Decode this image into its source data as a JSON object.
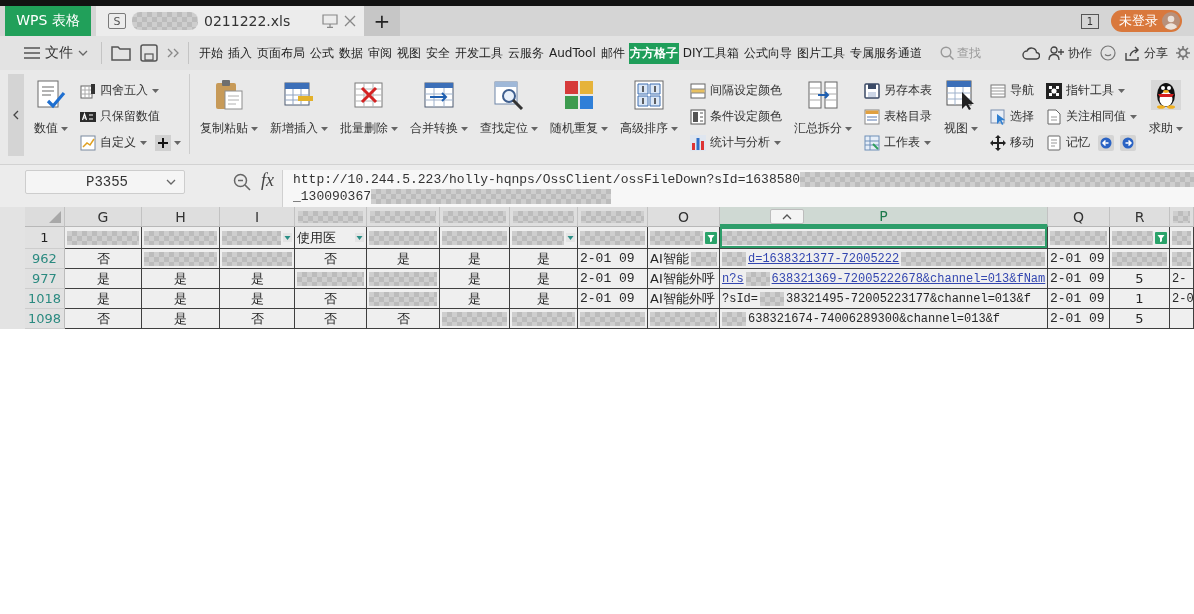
{
  "title_bar": {
    "app_tab": "WPS 表格",
    "file_tab": {
      "icon_letter": "S",
      "redacted": true,
      "name": "0211222.xls"
    },
    "new_tab": "+",
    "window_count": "1",
    "account": "未登录"
  },
  "menu_bar": {
    "file_menu": "文件",
    "tabs": [
      {
        "label": "开始",
        "selected": false
      },
      {
        "label": "插入",
        "selected": false
      },
      {
        "label": "页面布局",
        "selected": false
      },
      {
        "label": "公式",
        "selected": false
      },
      {
        "label": "数据",
        "selected": false
      },
      {
        "label": "审阅",
        "selected": false
      },
      {
        "label": "视图",
        "selected": false
      },
      {
        "label": "安全",
        "selected": false
      },
      {
        "label": "开发工具",
        "selected": false
      },
      {
        "label": "云服务",
        "selected": false
      },
      {
        "label": "AudTool",
        "selected": false
      },
      {
        "label": "邮件",
        "selected": false
      },
      {
        "label": "方方格子",
        "selected": true
      },
      {
        "label": "DIY工具箱",
        "selected": false
      },
      {
        "label": "公式向导",
        "selected": false
      },
      {
        "label": "图片工具",
        "selected": false
      },
      {
        "label": "专属服务通道",
        "selected": false
      }
    ],
    "search": {
      "placeholder": "查找"
    },
    "collaborate": "协作",
    "share": "分享"
  },
  "ribbon": {
    "sections": [
      {
        "kind": "large",
        "label": "数值",
        "dropdown": true
      },
      {
        "kind": "stack",
        "rows": [
          [
            {
              "label": "四舍五入",
              "dropdown": true
            }
          ],
          [
            {
              "label": "只保留数值",
              "dropdown": false
            }
          ],
          [
            {
              "label": "自定义",
              "dropdown": true
            },
            {
              "dropdown": true
            }
          ]
        ]
      },
      {
        "kind": "separator"
      },
      {
        "kind": "large",
        "label": "复制粘贴",
        "dropdown": true
      },
      {
        "kind": "large",
        "label": "新增插入",
        "dropdown": true
      },
      {
        "kind": "large",
        "label": "批量删除",
        "dropdown": true
      },
      {
        "kind": "large",
        "label": "合并转换",
        "dropdown": true
      },
      {
        "kind": "large",
        "label": "查找定位",
        "dropdown": true
      },
      {
        "kind": "large",
        "label": "随机重复",
        "dropdown": true
      },
      {
        "kind": "large",
        "label": "高级排序",
        "dropdown": true
      },
      {
        "kind": "stack",
        "rows": [
          [
            {
              "label": "间隔设定颜色",
              "dropdown": false
            }
          ],
          [
            {
              "label": "条件设定颜色",
              "dropdown": false
            }
          ],
          [
            {
              "label": "统计与分析",
              "dropdown": true
            }
          ]
        ]
      },
      {
        "kind": "large",
        "label": "汇总拆分",
        "dropdown": true
      },
      {
        "kind": "stack",
        "rows": [
          [
            {
              "label": "另存本表",
              "dropdown": false
            }
          ],
          [
            {
              "label": "表格目录",
              "dropdown": false
            }
          ],
          [
            {
              "label": "工作表",
              "dropdown": true
            }
          ]
        ]
      },
      {
        "kind": "large",
        "label": "视图",
        "dropdown": true
      },
      {
        "kind": "stack",
        "rows": [
          [
            {
              "label": "导航",
              "dropdown": false
            }
          ],
          [
            {
              "label": "选择",
              "dropdown": false
            }
          ],
          [
            {
              "label": "移动",
              "dropdown": false
            }
          ]
        ]
      },
      {
        "kind": "stack",
        "rows": [
          [
            {
              "label": "指针工具",
              "dropdown": true
            }
          ],
          [
            {
              "label": "关注相同值",
              "dropdown": true
            }
          ],
          [
            {
              "label": "记忆",
              "dropdown": false
            },
            {
              "dropdown": false
            },
            {
              "dropdown": false
            }
          ]
        ]
      },
      {
        "kind": "large",
        "label": "求助",
        "dropdown": true
      }
    ]
  },
  "formula_bar": {
    "cell_name": "P3355",
    "function_label": "fx",
    "lines": [
      {
        "text": "http://10.244.5.223/holly-hqnps/OssClient/ossFileDown?sId=1638580",
        "redacted": true
      },
      {
        "text": "_130090367",
        "redacted": true
      }
    ]
  },
  "sheet": {
    "columns": [
      {
        "kind": "letter",
        "letter": "G",
        "selected": false
      },
      {
        "kind": "letter",
        "letter": "H",
        "selected": false
      },
      {
        "kind": "letter",
        "letter": "I",
        "selected": false
      },
      {
        "kind": "blur",
        "selected": false
      },
      {
        "kind": "blur",
        "selected": false
      },
      {
        "kind": "blur",
        "selected": false
      },
      {
        "kind": "blur",
        "selected": false
      },
      {
        "kind": "blur",
        "selected": false
      },
      {
        "kind": "letter",
        "letter": "O",
        "selected": false
      },
      {
        "kind": "letter",
        "letter": "P",
        "selected": true
      },
      {
        "kind": "letter",
        "letter": "Q",
        "selected": false
      },
      {
        "kind": "letter",
        "letter": "R",
        "selected": false
      },
      {
        "kind": "blur",
        "selected": false
      }
    ],
    "header_row": {
      "number": "1",
      "filtered": false,
      "cells": [
        {
          "kind": "blur",
          "filter": false,
          "filter_active": false
        },
        {
          "kind": "blur",
          "filter": false,
          "filter_active": false
        },
        {
          "kind": "blur",
          "filter": true,
          "filter_active": false
        },
        {
          "kind": "text",
          "text": "使用医",
          "filter": true,
          "filter_active": false
        },
        {
          "kind": "blur",
          "filter": false,
          "filter_active": false
        },
        {
          "kind": "blur",
          "filter": false,
          "filter_active": false
        },
        {
          "kind": "blur",
          "filter": true,
          "filter_active": false
        },
        {
          "kind": "blur",
          "filter": false,
          "filter_active": false
        },
        {
          "kind": "blur",
          "filter": true,
          "filter_active": true
        },
        {
          "kind": "blur",
          "filter": false,
          "filter_active": false
        },
        {
          "kind": "blur",
          "filter": false,
          "filter_active": false
        },
        {
          "kind": "blur",
          "filter": true,
          "filter_active": true
        },
        {
          "kind": "blur",
          "filter": false,
          "filter_active": false
        }
      ]
    },
    "rows": [
      {
        "number": "962",
        "filtered": true,
        "cells": [
          {
            "kind": "text",
            "text": "否"
          },
          {
            "kind": "blur"
          },
          {
            "kind": "blur"
          },
          {
            "kind": "text",
            "text": "否"
          },
          {
            "kind": "text",
            "text": "是"
          },
          {
            "kind": "text",
            "text": "是"
          },
          {
            "kind": "text",
            "text": "是"
          },
          {
            "kind": "text",
            "text": "2-01 09"
          },
          {
            "kind": "mixed",
            "parts": [
              {
                "kind": "text",
                "text": "AI智能",
                "link": false
              },
              {
                "kind": "blur"
              }
            ]
          },
          {
            "kind": "mixed",
            "parts": [
              {
                "kind": "blur"
              },
              {
                "kind": "text",
                "text": "d=1638321377-72005222",
                "link": true
              },
              {
                "kind": "blur"
              }
            ]
          },
          {
            "kind": "text",
            "text": "2-01 09"
          },
          {
            "kind": "blur"
          },
          {
            "kind": "blur"
          }
        ]
      },
      {
        "number": "977",
        "filtered": true,
        "cells": [
          {
            "kind": "text",
            "text": "是"
          },
          {
            "kind": "text",
            "text": "是"
          },
          {
            "kind": "text",
            "text": "是"
          },
          {
            "kind": "blur"
          },
          {
            "kind": "blur"
          },
          {
            "kind": "text",
            "text": "是"
          },
          {
            "kind": "text",
            "text": "是"
          },
          {
            "kind": "text",
            "text": "2-01 09"
          },
          {
            "kind": "text",
            "text": "AI智能外呼"
          },
          {
            "kind": "mixed",
            "parts": [
              {
                "kind": "text",
                "text": "n?s",
                "link": true
              },
              {
                "kind": "blur"
              },
              {
                "kind": "text",
                "text": "638321369-72005222678&channel=013&fNam",
                "link": true
              }
            ]
          },
          {
            "kind": "text",
            "text": "2-01 09"
          },
          {
            "kind": "text",
            "text": "5"
          },
          {
            "kind": "text",
            "text": "2-"
          }
        ]
      },
      {
        "number": "1018",
        "filtered": true,
        "cells": [
          {
            "kind": "text",
            "text": "是"
          },
          {
            "kind": "text",
            "text": "是"
          },
          {
            "kind": "text",
            "text": "是"
          },
          {
            "kind": "text",
            "text": "否"
          },
          {
            "kind": "blur"
          },
          {
            "kind": "text",
            "text": "是"
          },
          {
            "kind": "text",
            "text": "是"
          },
          {
            "kind": "text",
            "text": "2-01 09"
          },
          {
            "kind": "text",
            "text": "AI智能外呼"
          },
          {
            "kind": "mixed",
            "parts": [
              {
                "kind": "text",
                "text": "?sId=",
                "link": false
              },
              {
                "kind": "blur"
              },
              {
                "kind": "text",
                "text": "38321495-72005223177&channel=013&f",
                "link": false
              }
            ]
          },
          {
            "kind": "text",
            "text": "2-01 09"
          },
          {
            "kind": "text",
            "text": "1"
          },
          {
            "kind": "text",
            "text": "2-0"
          }
        ]
      },
      {
        "number": "1098",
        "filtered": true,
        "cells": [
          {
            "kind": "text",
            "text": "否"
          },
          {
            "kind": "text",
            "text": "是"
          },
          {
            "kind": "text",
            "text": "否"
          },
          {
            "kind": "text",
            "text": "否"
          },
          {
            "kind": "text",
            "text": "否"
          },
          {
            "kind": "blur"
          },
          {
            "kind": "blur"
          },
          {
            "kind": "blur"
          },
          {
            "kind": "blur"
          },
          {
            "kind": "mixed",
            "parts": [
              {
                "kind": "blur"
              },
              {
                "kind": "text",
                "text": "638321674-74006289300&channel=013&f",
                "link": false
              }
            ]
          },
          {
            "kind": "text",
            "text": "2-01 09"
          },
          {
            "kind": "text",
            "text": "5"
          },
          {
            "kind": "empty"
          }
        ]
      }
    ]
  }
}
